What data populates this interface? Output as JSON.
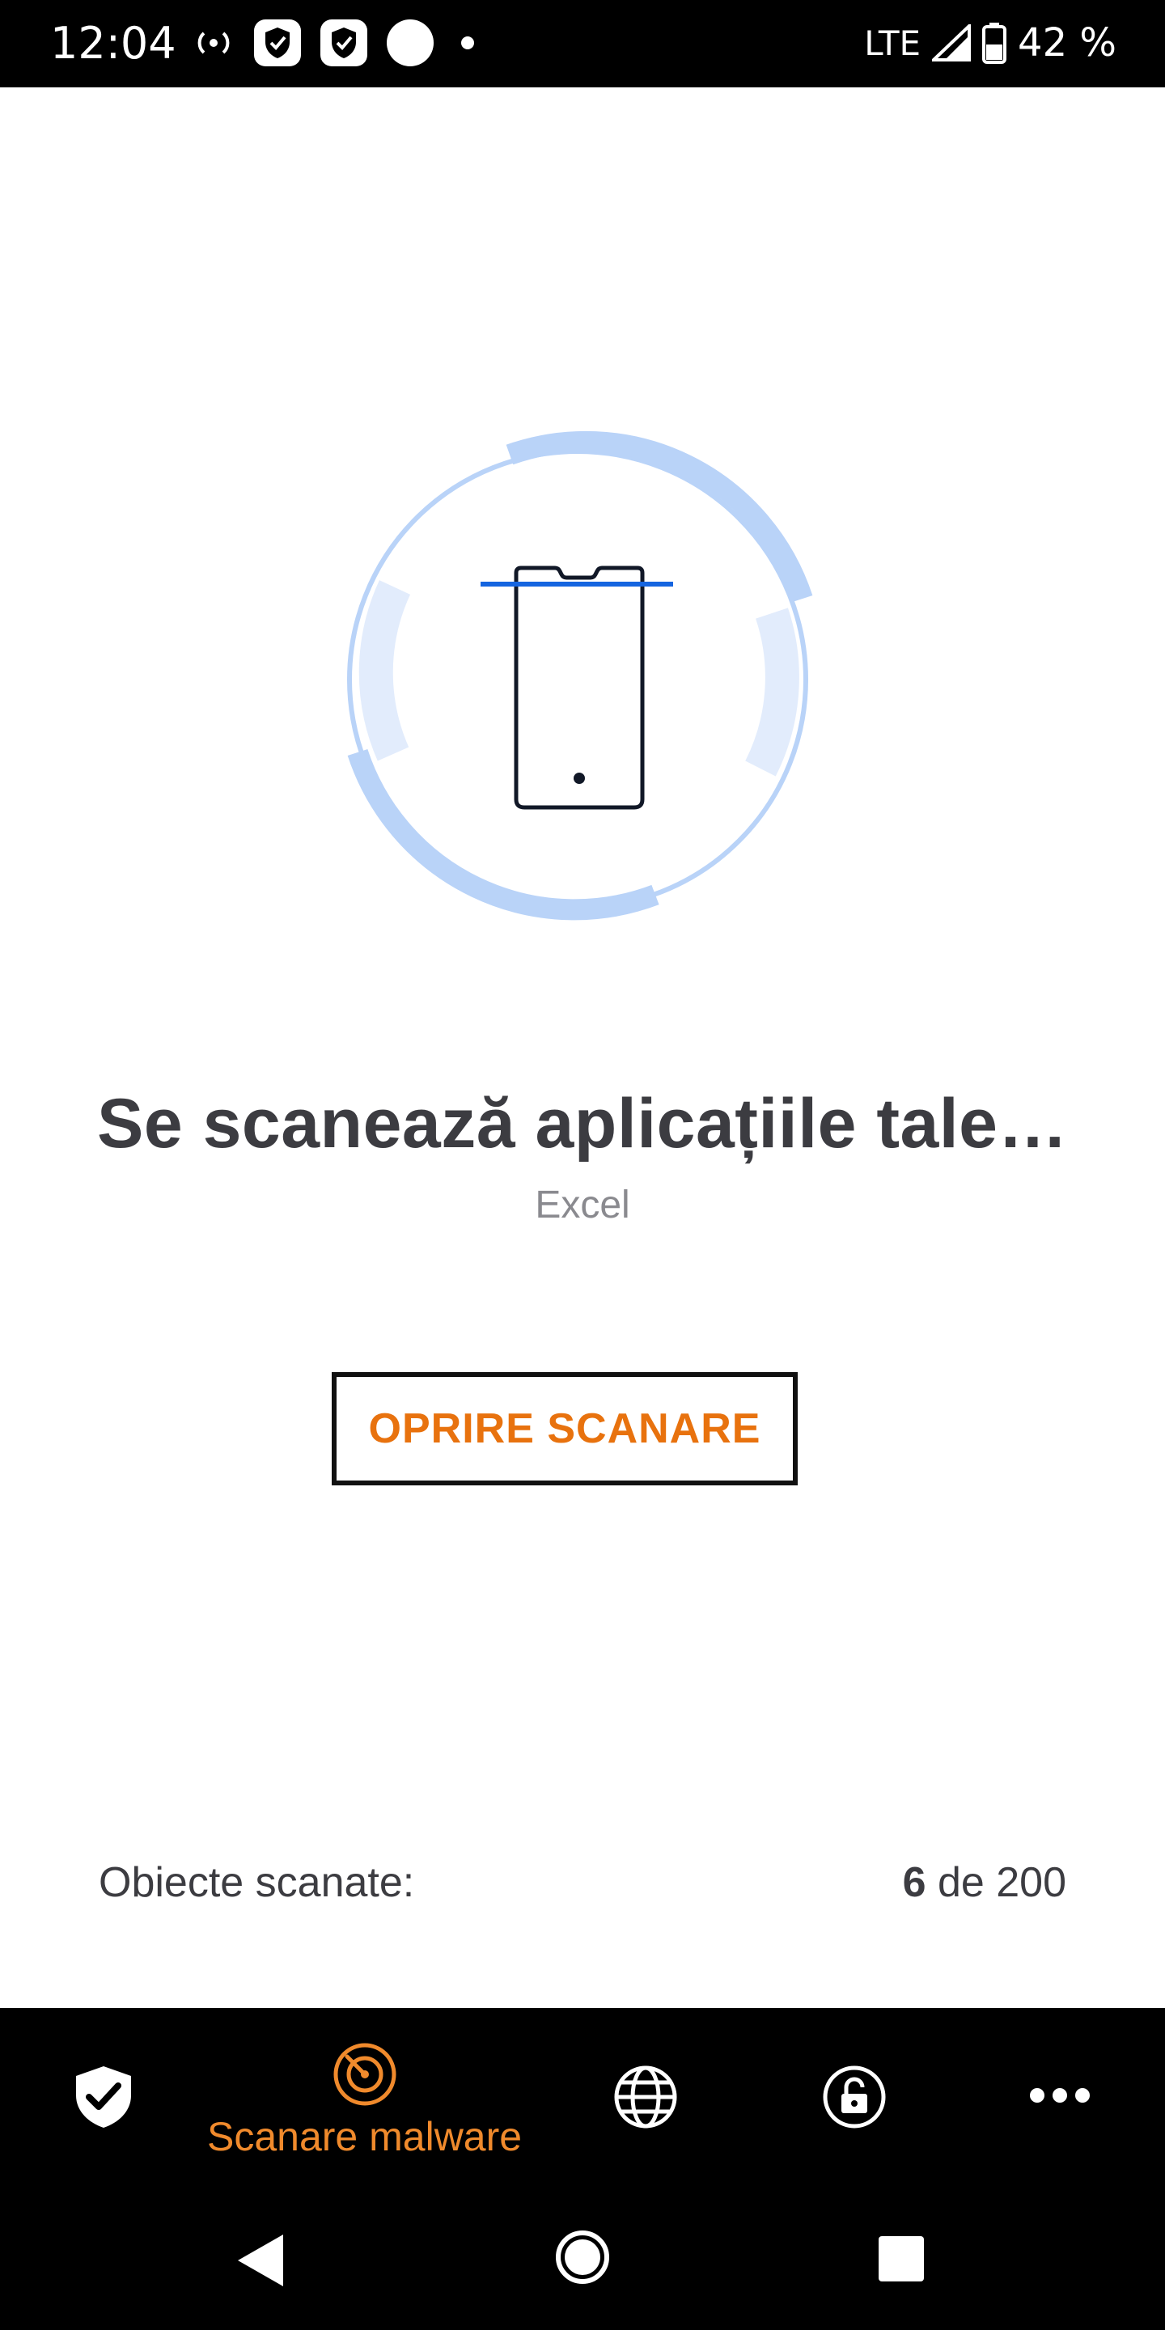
{
  "status_bar": {
    "time": "12:04",
    "network": "LTE",
    "battery": "42 %"
  },
  "scan": {
    "title": "Se scanează aplicațiile tale…",
    "current_item": "Excel",
    "stop_label": "OPRIRE SCANARE",
    "scanned_label": "Obiecte scanate:",
    "scanned_count": "6",
    "scanned_separator": " de ",
    "scanned_total": "200"
  },
  "bottom_nav": {
    "items": [
      {
        "icon": "shield-check-icon",
        "label": ""
      },
      {
        "icon": "malware-scan-icon",
        "label": "Scanare malware",
        "active": true
      },
      {
        "icon": "globe-icon",
        "label": ""
      },
      {
        "icon": "lock-icon",
        "label": ""
      },
      {
        "icon": "more-icon",
        "label": ""
      }
    ]
  },
  "colors": {
    "accent_orange": "#e8720e",
    "scan_line_blue": "#1565e0",
    "ring_blue": "#b9d3f8"
  }
}
